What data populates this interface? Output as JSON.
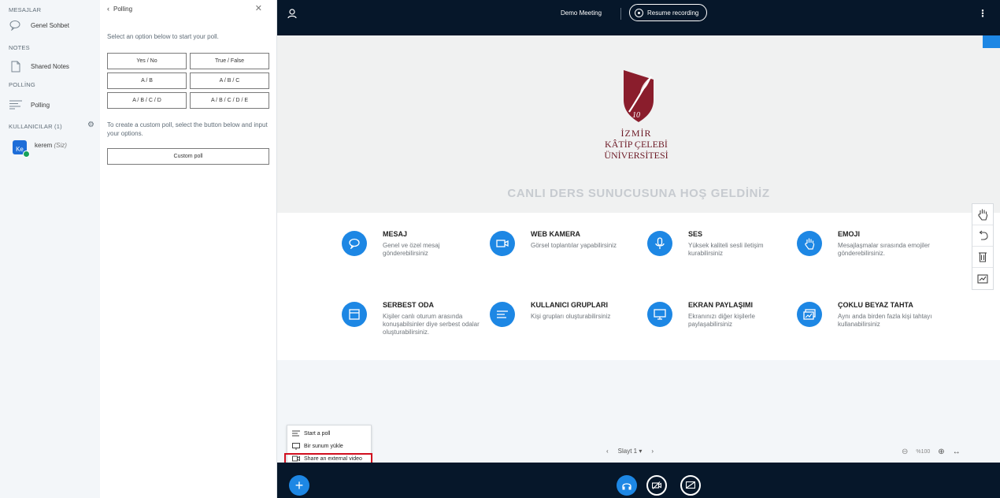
{
  "sidebar": {
    "messages_title": "MESAJLAR",
    "public_chat": "Genel Sohbet",
    "notes_title": "NOTES",
    "shared_notes": "Shared Notes",
    "polling_title": "POLLİNG",
    "polling_item": "Polling",
    "users_title": "KULLANICILAR (1)",
    "user": {
      "avatar": "Ke",
      "name": "kerem",
      "you": "(Siz)"
    }
  },
  "poll": {
    "back_label": "Polling",
    "intro": "Select an option below to start your poll.",
    "options": [
      "Yes / No",
      "True / False",
      "A / B",
      "A / B / C",
      "A / B / C / D",
      "A / B / C / D / E"
    ],
    "custom_text": "To create a custom poll, select the button below and input your options.",
    "custom_button": "Custom poll"
  },
  "topbar": {
    "meeting_name": "Demo Meeting",
    "record_label": "Resume recording"
  },
  "slide": {
    "logo_lines": [
      "İZMİR",
      "KÂTİP ÇELEBİ",
      "ÜNİVERSİTESİ"
    ],
    "title": "CANLI DERS SUNUCUSUNA HOŞ GELDİNİZ",
    "features": [
      {
        "icon": "chat-icon",
        "title": "MESAJ",
        "desc": "Genel ve özel mesaj gönderebilirsiniz"
      },
      {
        "icon": "webcam-icon",
        "title": "WEB KAMERA",
        "desc": "Görsel toplantılar yapabilirsiniz"
      },
      {
        "icon": "microphone-icon",
        "title": "SES",
        "desc": "Yüksek kaliteli sesli iletişim kurabilirsiniz"
      },
      {
        "icon": "hand-icon",
        "title": "EMOJI",
        "desc": "Mesajlaşmalar sırasında emojiler gönderebilirsiniz."
      },
      {
        "icon": "breakout-room-icon",
        "title": "SERBEST ODA",
        "desc": "Kişiler canlı oturum arasında konuşabilsinler diye serbest odalar oluşturabilirsiniz."
      },
      {
        "icon": "user-groups-icon",
        "title": "KULLANICI GRUPLARI",
        "desc": "Kişi grupları oluşturabilirsiniz"
      },
      {
        "icon": "screen-share-icon",
        "title": "EKRAN PAYLAŞIMI",
        "desc": "Ekranınızı diğer kişilerle paylaşabilirsiniz"
      },
      {
        "icon": "whiteboard-icon",
        "title": "ÇOKLU BEYAZ TAHTA",
        "desc": "Aynı anda birden fazla kişi tahtayı kullanabilirsiniz"
      }
    ]
  },
  "slide_controls": {
    "slide_label": "Slayt 1",
    "zoom_label": "%100"
  },
  "action_menu": {
    "items": [
      "Start a poll",
      "Bir sunum yükle",
      "Share an external video"
    ]
  },
  "colors": {
    "accent": "#1d87e4",
    "dark_bar": "#06172a",
    "highlight": "#d10f1f"
  }
}
